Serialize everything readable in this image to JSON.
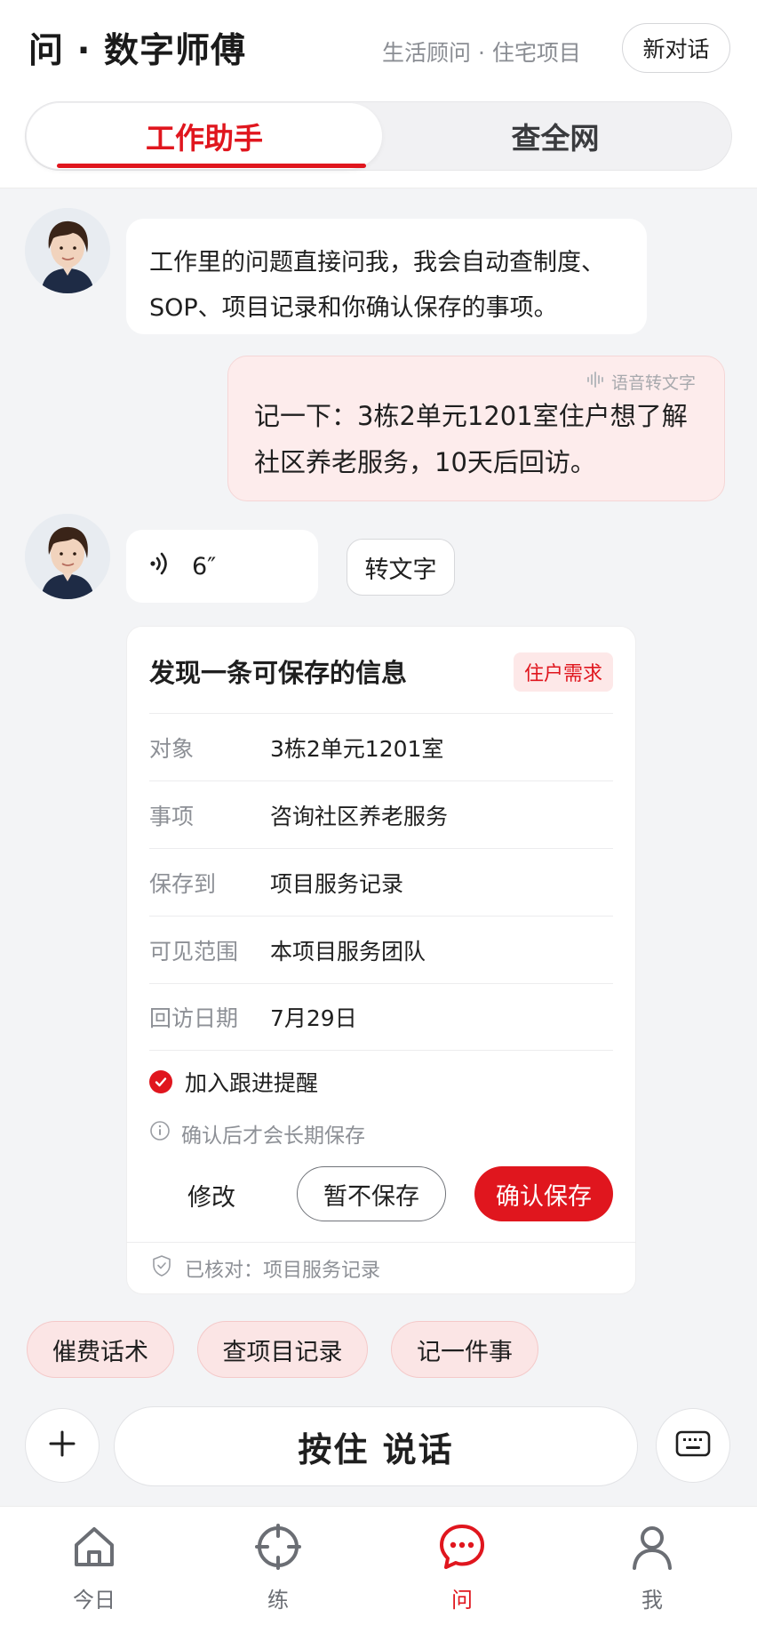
{
  "header": {
    "title": "问 · 数字师傅",
    "subtitle": "生活顾问 · 住宅项目",
    "new_chat_label": "新对话"
  },
  "tabs": [
    {
      "label": "工作助手",
      "active": true
    },
    {
      "label": "查全网",
      "active": false
    }
  ],
  "messages": {
    "bot_intro_line1": "工作里的问题直接问我，我会自动查制度、",
    "bot_intro_line2": "SOP、项目记录和你确认保存的事项。",
    "user_voice_tag": "语音转文字",
    "user_text_line1": "记一下：3栋2单元1201室住户想了解",
    "user_text_line2": "社区养老服务，10天后回访。",
    "voice_duration": "6″",
    "to_text_label": "转文字"
  },
  "save_card": {
    "title": "发现一条可保存的信息",
    "tag": "住户需求",
    "rows": [
      {
        "label": "对象",
        "value": "3栋2单元1201室"
      },
      {
        "label": "事项",
        "value": "咨询社区养老服务"
      },
      {
        "label": "保存到",
        "value": "项目服务记录"
      },
      {
        "label": "可见范围",
        "value": "本项目服务团队"
      },
      {
        "label": "回访日期",
        "value": "7月29日"
      }
    ],
    "reminder_label": "加入跟进提醒",
    "reminder_checked": true,
    "info_text": "确认后才会长期保存",
    "edit_label": "修改",
    "skip_label": "暂不保存",
    "confirm_label": "确认保存",
    "verified_text": "已核对：项目服务记录"
  },
  "quick_chips": [
    "催费话术",
    "查项目记录",
    "记一件事"
  ],
  "input_bar": {
    "hold_to_talk": "按住 说话"
  },
  "bottom_nav": [
    {
      "label": "今日",
      "icon": "home-icon",
      "active": false
    },
    {
      "label": "练",
      "icon": "target-icon",
      "active": false
    },
    {
      "label": "问",
      "icon": "chat-icon",
      "active": true
    },
    {
      "label": "我",
      "icon": "user-icon",
      "active": false
    }
  ],
  "colors": {
    "accent": "#e0161e",
    "user_bubble": "#fdecec",
    "background": "#f3f4f6"
  }
}
